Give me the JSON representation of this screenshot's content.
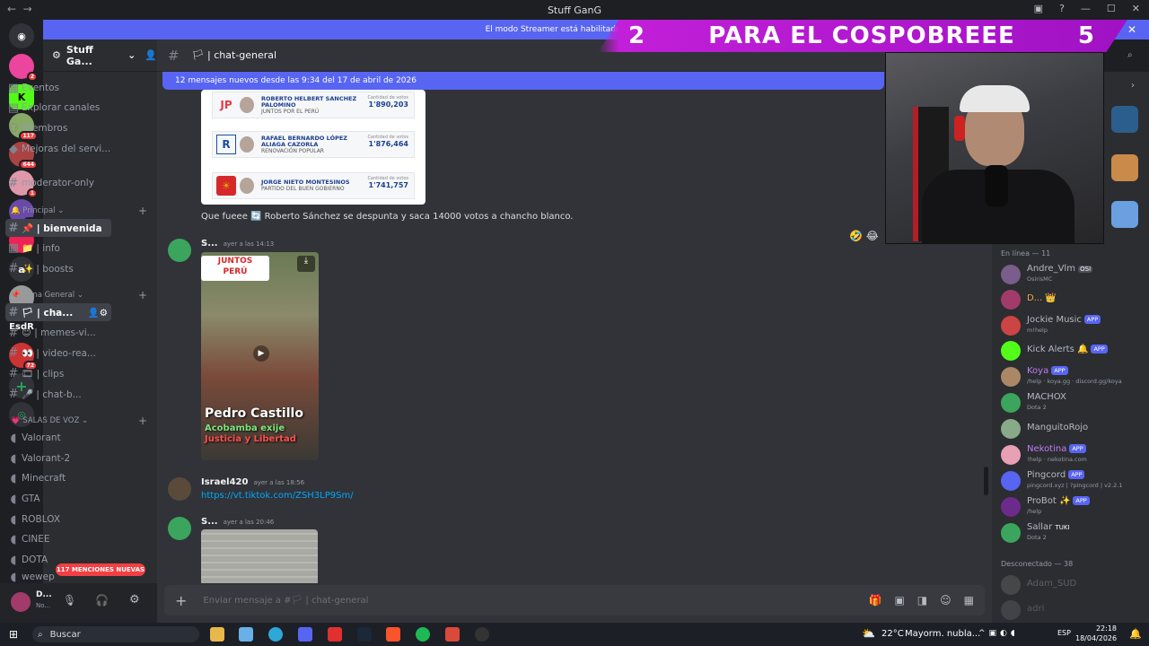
{
  "window": {
    "title": "Stuff GanG"
  },
  "streamer_banner": "El modo Streamer está habilitado. Los nombres de usu",
  "overlay": {
    "left_num": "2",
    "text": "PARA EL COSPOBREEE",
    "right_num": "5"
  },
  "server": {
    "name": "Stuff Ga...",
    "nav": [
      {
        "label": "Eventos",
        "icon": "calendar-icon"
      },
      {
        "label": "Explorar canales",
        "icon": "compass-icon"
      },
      {
        "label": "Miembros",
        "icon": "members-icon"
      },
      {
        "label": "Mejoras del servi...",
        "icon": "boost-icon"
      }
    ],
    "channels_top": [
      {
        "label": "moderator-only"
      }
    ],
    "categories": [
      {
        "label": "Principal",
        "channels": [
          "📌 | bienvenida",
          "📁 | info",
          "✨ | boosts"
        ]
      },
      {
        "label": "Zona General",
        "channels": [
          "🏳 | cha...",
          "😊 | memes-vi...",
          "👀 | video-rea...",
          "🎞 | clips",
          "🎤 | chat-b..."
        ]
      },
      {
        "label": "SALAS DE VOZ",
        "channels": [
          "Valorant",
          "Valorant-2",
          "Minecraft",
          "GTA",
          "ROBLOX",
          "CINEE",
          "DOTA",
          "wewep"
        ]
      }
    ],
    "mentions_badge": "117 MENCIONES NUEVAS"
  },
  "user_panel": {
    "name": "D...",
    "status": "No..."
  },
  "server_list": [
    {
      "label": "",
      "badge": ""
    },
    {
      "label": "",
      "badge": "2"
    },
    {
      "label": "",
      "badge": ""
    },
    {
      "label": "",
      "badge": "117"
    },
    {
      "label": "",
      "badge": "644"
    },
    {
      "label": "",
      "badge": "1"
    },
    {
      "label": "",
      "badge": "50"
    },
    {
      "label": "",
      "badge": ""
    },
    {
      "label": "a",
      "badge": ""
    },
    {
      "label": "",
      "badge": "5"
    },
    {
      "label": "EsdR",
      "badge": ""
    },
    {
      "label": "",
      "badge": "72"
    }
  ],
  "chat": {
    "channel": "🏳 | chat-general",
    "new_messages": "12 mensajes nuevos desde las 9:34 del 17 de abril de 2026",
    "vote_card": [
      {
        "logo": "JP",
        "name": "ROBERTO HELBERT SANCHEZ PALOMINO",
        "party": "JUNTOS POR EL PERÚ",
        "label": "Cantidad de votos",
        "votes": "1'890,203",
        "color": "#e63946"
      },
      {
        "logo": "R",
        "name": "RAFAEL BERNARDO LÓPEZ ALIAGA CAZORLA",
        "party": "RENOVACIÓN POPULAR",
        "label": "Cantidad de votos",
        "votes": "1'876,464",
        "color": "#1d4f9e"
      },
      {
        "logo": "☀",
        "name": "JORGE NIETO MONTESINOS",
        "party": "PARTIDO DEL BUEN GOBIERNO",
        "label": "Cantidad de votos",
        "votes": "1'741,757",
        "color": "#e0a800"
      }
    ],
    "message1": "Que fueee 🔄 Roberto Sánchez se despunta y saca 14000 votos a chancho blanco.",
    "message2": {
      "author": "S...",
      "time": "ayer a las 14:13"
    },
    "video": {
      "logo_top": "JUNTOS",
      "logo_bottom": "PERÚ",
      "title": "Pedro Castillo",
      "sub1": "Acobamba exije",
      "sub2": "Justicia y Libertad"
    },
    "message3": {
      "author": "Israel420",
      "time": "ayer a las 18:56",
      "link": "https://vt.tiktok.com/ZSH3LP9Sm/"
    },
    "message4": {
      "author": "S...",
      "time": "ayer a las 20:46"
    },
    "composer_placeholder": "Enviar mensaje a #🏳 | chat-general"
  },
  "members": {
    "online_header": "En línea — 11",
    "online": [
      {
        "name": "Andre_Vlm",
        "tag": "OSI",
        "status": "OsirisMC",
        "color": "#b5bac1",
        "avatar": "#7a5d8a"
      },
      {
        "name": "D... 👑",
        "tag": "",
        "status": "",
        "color": "#e6a94a",
        "avatar": "#a23b6a"
      },
      {
        "name": "Jockie Music",
        "tag": "APP",
        "status": "m!help",
        "color": "#b5bac1",
        "avatar": "#c44"
      },
      {
        "name": "Kick Alerts 🔔",
        "tag": "APP",
        "status": "",
        "color": "#b5bac1",
        "avatar": "#53fc18"
      },
      {
        "name": "Koya",
        "tag": "APP",
        "status": "/help · koya.gg · discord.gg/koya",
        "color": "#c27cf4",
        "avatar": "#a86"
      },
      {
        "name": "MACHOX",
        "tag": "",
        "status": "Dota 2",
        "color": "#b5bac1",
        "avatar": "#3ba55d"
      },
      {
        "name": "ManguitoRojo",
        "tag": "",
        "status": "",
        "color": "#b5bac1",
        "avatar": "#8a8"
      },
      {
        "name": "Nekotina",
        "tag": "APP",
        "status": "!help · nekotina.com",
        "color": "#c27cf4",
        "avatar": "#e8a0b4"
      },
      {
        "name": "Pingcord",
        "tag": "APP",
        "status": "pingcord.xyz | ?pingcord | v2.2.1",
        "color": "#b5bac1",
        "avatar": "#5865f2"
      },
      {
        "name": "ProBot ✨",
        "tag": "APP",
        "status": "/help",
        "color": "#b5bac1",
        "avatar": "#6c2a8c"
      },
      {
        "name": "Sallar",
        "tag": "TUKI",
        "status": "Dota 2",
        "color": "#b5bac1",
        "avatar": "#3ba55d"
      }
    ],
    "offline_header": "Desconectado — 38",
    "offline": [
      {
        "name": "Adam_SUD"
      },
      {
        "name": "adri"
      }
    ]
  },
  "taskbar": {
    "search": "Buscar",
    "weather": "22°C",
    "weather_desc": "Mayorm. nubla...",
    "lang": "ESP",
    "time": "22:18",
    "date": "18/04/2026"
  }
}
